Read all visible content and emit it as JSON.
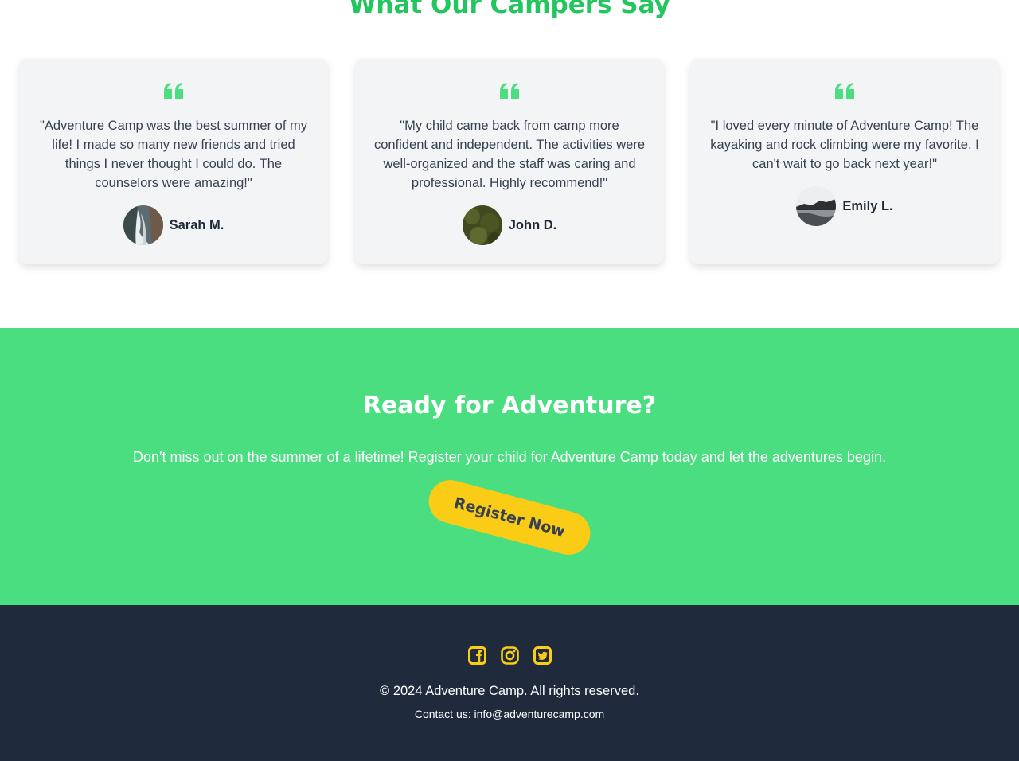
{
  "testimonials": {
    "title": "What Our Campers Say",
    "items": [
      {
        "quote": "\"Adventure Camp was the best summer of my life! I made so many new friends and tried things I never thought I could do. The counselors were amazing!\"",
        "author": "Sarah M.",
        "avatar_icon": "waterfall-photo"
      },
      {
        "quote": "\"My child came back from camp more confident and independent. The activities were well-organized and the staff was caring and professional. Highly recommend!\"",
        "author": "John D.",
        "avatar_icon": "forest-photo"
      },
      {
        "quote": "\"I loved every minute of Adventure Camp! The kayaking and rock climbing were my favorite. I can't wait to go back next year!\"",
        "author": "Emily L.",
        "avatar_icon": "coast-photo"
      }
    ],
    "quote_icon": "quote-left-icon",
    "accent_color": "#4ade80"
  },
  "cta": {
    "title": "Ready for Adventure?",
    "text": "Don't miss out on the summer of a lifetime! Register your child for Adventure Camp today and let the adventures begin.",
    "button_label": "Register Now",
    "background_color": "#4ade80",
    "button_color": "#facc15"
  },
  "footer": {
    "social": [
      "facebook-icon",
      "instagram-icon",
      "twitter-icon"
    ],
    "copyright": "© 2024 Adventure Camp. All rights reserved.",
    "contact": "Contact us: info@adventurecamp.com",
    "background_color": "#1f2a3c",
    "icon_color": "#facc15"
  }
}
